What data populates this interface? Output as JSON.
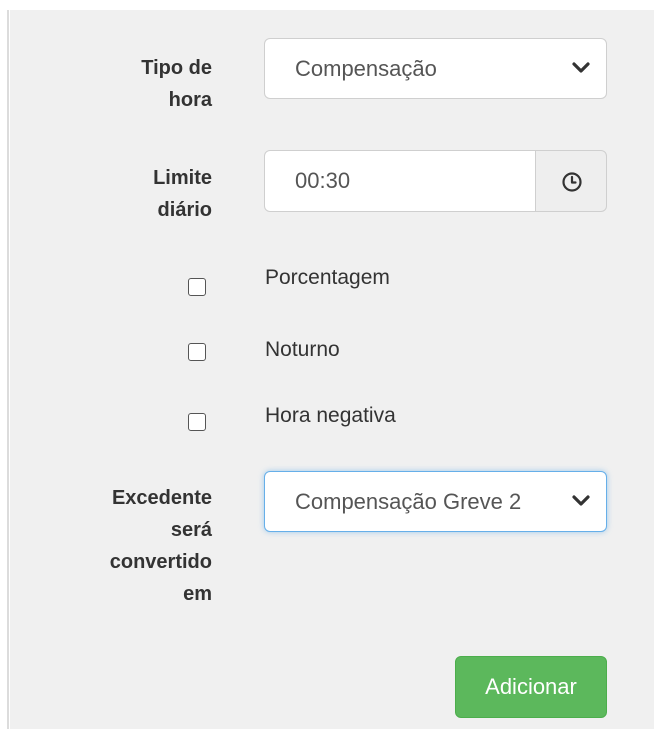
{
  "form": {
    "tipo_hora": {
      "label_line1": "Tipo de",
      "label_line2": "hora",
      "selected": "Compensação",
      "icon": "chevron-down-icon"
    },
    "limite_diario": {
      "label_line1": "Limite",
      "label_line2": "diário",
      "value": "00:30",
      "icon": "clock-icon"
    },
    "checkboxes": [
      {
        "label": "Porcentagem",
        "checked": false
      },
      {
        "label": "Noturno",
        "checked": false
      },
      {
        "label": "Hora negativa",
        "checked": false
      }
    ],
    "excedente": {
      "label_line1": "Excedente",
      "label_line2": "será",
      "label_line3": "convertido",
      "label_line4": "em",
      "selected": "Compensação Greve 2",
      "icon": "chevron-down-icon"
    },
    "submit_label": "Adicionar"
  },
  "colors": {
    "panel_bg": "#f0f0f0",
    "button_green": "#5cb85c",
    "focus_blue": "#66afe9"
  }
}
